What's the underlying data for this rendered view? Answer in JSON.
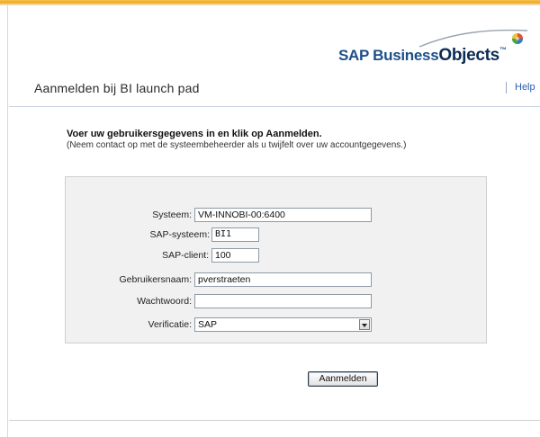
{
  "brand": {
    "name_part1": "SAP Business",
    "name_part2": "Objects",
    "trademark": "™"
  },
  "header": {
    "title": "Aanmelden bij BI launch pad",
    "help_label": "Help"
  },
  "intro": {
    "heading": "Voer uw gebruikersgegevens in en klik op Aanmelden.",
    "note": "(Neem contact op met de systeembeheerder als u twijfelt over uw accountgegevens.)"
  },
  "form": {
    "system": {
      "label": "Systeem:",
      "value": "VM-INNOBI-00:6400"
    },
    "sap_system": {
      "label": "SAP-systeem:",
      "value": "BI1"
    },
    "sap_client": {
      "label": "SAP-client:",
      "value": "100"
    },
    "username": {
      "label": "Gebruikersnaam:",
      "value": "pverstraeten"
    },
    "password": {
      "label": "Wachtwoord:",
      "value": ""
    },
    "authentication": {
      "label": "Verificatie:",
      "selected": "SAP"
    },
    "submit_label": "Aanmelden"
  },
  "colors": {
    "accent_bar": "#f0a81c",
    "brand_blue": "#1d4f86",
    "link": "#2a5db0",
    "panel_bg": "#f1f1f1"
  }
}
